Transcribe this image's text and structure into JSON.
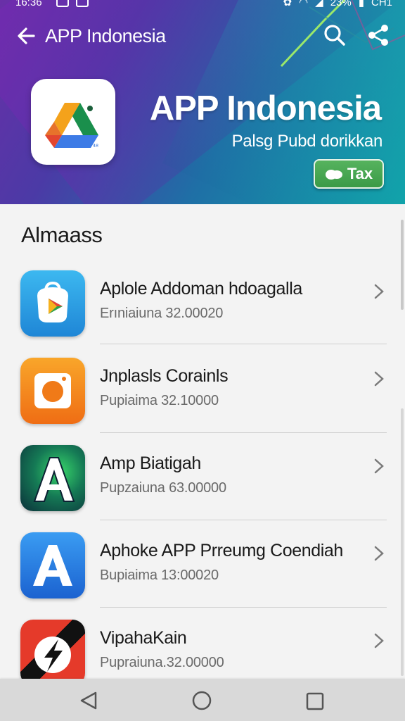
{
  "status": {
    "time": "16:36",
    "battery": "23%",
    "carrier": "CH1"
  },
  "appbar": {
    "title": "APP Indonesia"
  },
  "hero": {
    "title": "APP Indonesia",
    "subtitle": "Palsg Pubd dorikkan",
    "button_label": "Tax",
    "icon": "google-drive-icon"
  },
  "section": {
    "title": "Almaass"
  },
  "items": [
    {
      "title": "Aplole Addoman hdoagalla",
      "subtitle": "Erıniaiuna 32.00020",
      "icon": "play-store-bag-icon",
      "color": "#2fa6e6"
    },
    {
      "title": "Jnplasls Corainls",
      "subtitle": "Pupiaima 32.10000",
      "icon": "camera-icon",
      "color": "#f28a1e"
    },
    {
      "title": "Amp Biatigah",
      "subtitle": "Pupzaiuna 63.00000",
      "icon": "letter-a-neon-icon",
      "color": "#1d7f6a"
    },
    {
      "title": "Aphoke APP Prreumg Coendiah",
      "subtitle": "Bupiaima 13:00020",
      "icon": "letter-a-icon",
      "color": "#2c7ce6"
    },
    {
      "title": "VipahaKain",
      "subtitle": "Pupraiuna.32.00000",
      "icon": "lightning-icon",
      "color": "#d42a2a"
    }
  ],
  "navbar": {
    "back": "nav-back-icon",
    "home": "nav-home-icon",
    "recent": "nav-recent-icon"
  }
}
